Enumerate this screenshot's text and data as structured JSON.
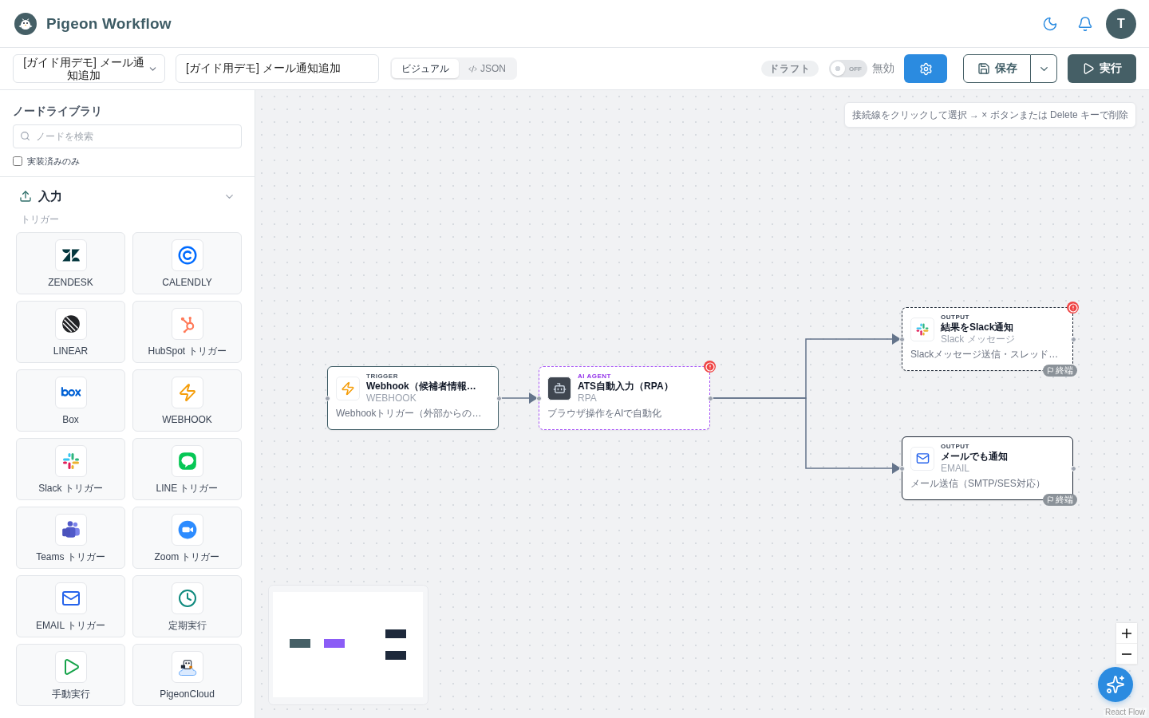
{
  "header": {
    "app_title": "Pigeon Workflow",
    "avatar_initial": "T"
  },
  "toolbar": {
    "workflow_select": {
      "value": "[ガイド用デモ] メール通知追加"
    },
    "name_field": {
      "value": "[ガイド用デモ] メール通知追加"
    },
    "view_tabs": [
      {
        "label": "ビジュアル",
        "kind": "visual",
        "selected": true
      },
      {
        "label": "JSON",
        "kind": "code",
        "selected": false
      }
    ],
    "status_badge": "ドラフト",
    "active_switch": {
      "on": false,
      "switch_text": "OFF",
      "label": "無効"
    },
    "save_button": "保存",
    "run_button": "実行"
  },
  "sidebar": {
    "title": "ノードライブラリ",
    "search": {
      "placeholder": "ノードを検索"
    },
    "implemented_only": {
      "label": "実装済みのみ",
      "checked": false
    },
    "section": {
      "title": "入力",
      "expanded": true,
      "group_label": "トリガー",
      "items": [
        {
          "label": "ZENDESK",
          "kind": "zendesk"
        },
        {
          "label": "CALENDLY",
          "kind": "calendly"
        },
        {
          "label": "LINEAR",
          "kind": "linear"
        },
        {
          "label": "HubSpot トリガー",
          "kind": "hubspot"
        },
        {
          "label": "Box",
          "kind": "box"
        },
        {
          "label": "WEBHOOK",
          "kind": "webhook"
        },
        {
          "label": "Slack トリガー",
          "kind": "slack"
        },
        {
          "label": "LINE トリガー",
          "kind": "line"
        },
        {
          "label": "Teams トリガー",
          "kind": "teams"
        },
        {
          "label": "Zoom トリガー",
          "kind": "zoom"
        },
        {
          "label": "EMAIL トリガー",
          "kind": "email"
        },
        {
          "label": "定期実行",
          "kind": "schedule"
        },
        {
          "label": "手動実行",
          "kind": "manual"
        },
        {
          "label": "PigeonCloud",
          "kind": "pigeoncloud"
        }
      ]
    }
  },
  "canvas": {
    "hint": "接続線をクリックして選択 → × ボタンまたは Delete キーで削除",
    "nodes": [
      {
        "kind": "webhook",
        "category": "TRIGGER",
        "title": "Webhook（候補者情報…",
        "subtitle": "WEBHOOK",
        "description": "Webhookトリガー（外部からの…",
        "error": false
      },
      {
        "kind": "rpa",
        "category": "AI AGENT",
        "title": "ATS自動入力（RPA）",
        "subtitle": "RPA",
        "description": "ブラウザ操作をAIで自動化",
        "error": true
      },
      {
        "kind": "slack",
        "category": "OUTPUT",
        "title": "結果をSlack通知",
        "subtitle": "Slack メッセージ",
        "description": "Slackメッセージ送信・スレッド…",
        "error": true,
        "end_tag": "終端"
      },
      {
        "kind": "email",
        "category": "OUTPUT",
        "title": "メールでも通知",
        "subtitle": "EMAIL",
        "description": "メール送信（SMTP/SES対応）",
        "error": false,
        "end_tag": "終端"
      }
    ],
    "attribution": "React Flow"
  }
}
